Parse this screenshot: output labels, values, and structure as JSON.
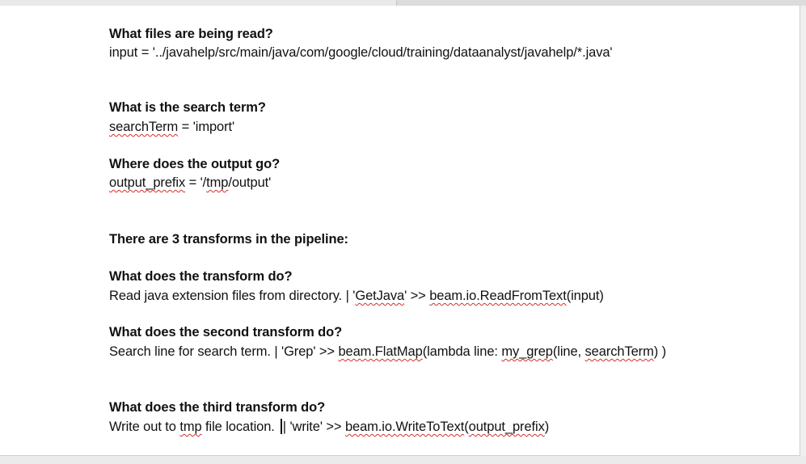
{
  "document": {
    "q1": {
      "question": "What files are being read?",
      "answer": "input = '../javahelp/src/main/java/com/google/cloud/training/dataanalyst/javahelp/*.java'"
    },
    "q2": {
      "question": "What is the search term?",
      "answer_var": "searchTerm",
      "answer_rest": " = 'import'"
    },
    "q3": {
      "question": "Where does the output go?",
      "answer_var": "output_prefix",
      "answer_eq": " = '/",
      "answer_tmp": "tmp",
      "answer_rest": "/output'"
    },
    "heading": "There are 3 transforms in the pipeline:",
    "t1": {
      "question": "What does the transform do?",
      "desc": "Read java extension files from directory. | '",
      "squiggle1": "GetJava",
      "mid": "' >> ",
      "squiggle2": "beam.io.ReadFromText",
      "end": "(input)"
    },
    "t2": {
      "question": "What does the second transform do?",
      "desc": "Search line for search term. | 'Grep' >> ",
      "squiggle1": "beam.FlatMap",
      "mid": "(lambda line: ",
      "squiggle2": "my_grep",
      "mid2": "(line, ",
      "squiggle3": "searchTerm",
      "end": ") )"
    },
    "t3": {
      "question": "What does the third transform do?",
      "desc1": "Write out to ",
      "squiggle1": "tmp",
      "desc2": " file location. ",
      "desc3": "| 'write' >> ",
      "squiggle2": "beam.io.WriteToText",
      "paren_open": "(",
      "squiggle3": "output_prefix",
      "end": ")"
    }
  }
}
